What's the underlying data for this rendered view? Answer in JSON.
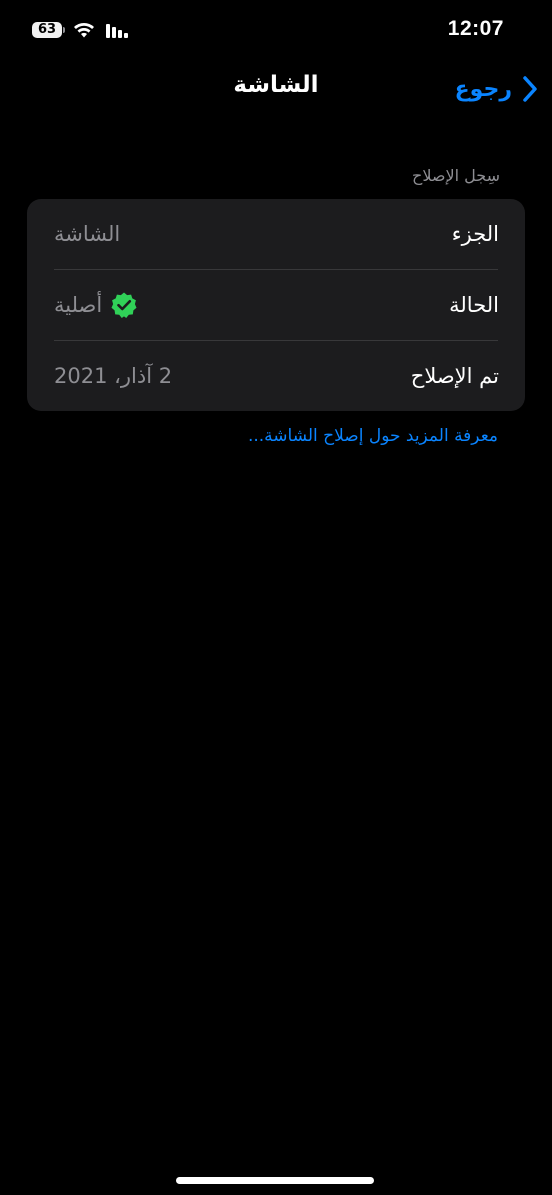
{
  "status_bar": {
    "battery_level": "63",
    "time": "12:07",
    "wifi_icon": "wifi-icon",
    "signal_icon": "cellular-signal-icon"
  },
  "nav": {
    "title": "الشاشة",
    "back_label": "رجوع",
    "back_icon": "chevron-right-icon"
  },
  "section": {
    "header": "سِجل الإصلاح"
  },
  "rows": [
    {
      "label": "الجزء",
      "value": "الشاشة"
    },
    {
      "label": "الحالة",
      "value": "أصلية",
      "icon": "verified-badge-icon"
    },
    {
      "label": "تم الإصلاح",
      "value": "2 آذار، 2021"
    }
  ],
  "learn_more": "معرفة المزيد حول إصلاح الشاشة...",
  "colors": {
    "background": "#000000",
    "card": "#1c1c1e",
    "accent": "#0a84ff",
    "secondary_text": "#8e8e93",
    "verified": "#30d158"
  }
}
